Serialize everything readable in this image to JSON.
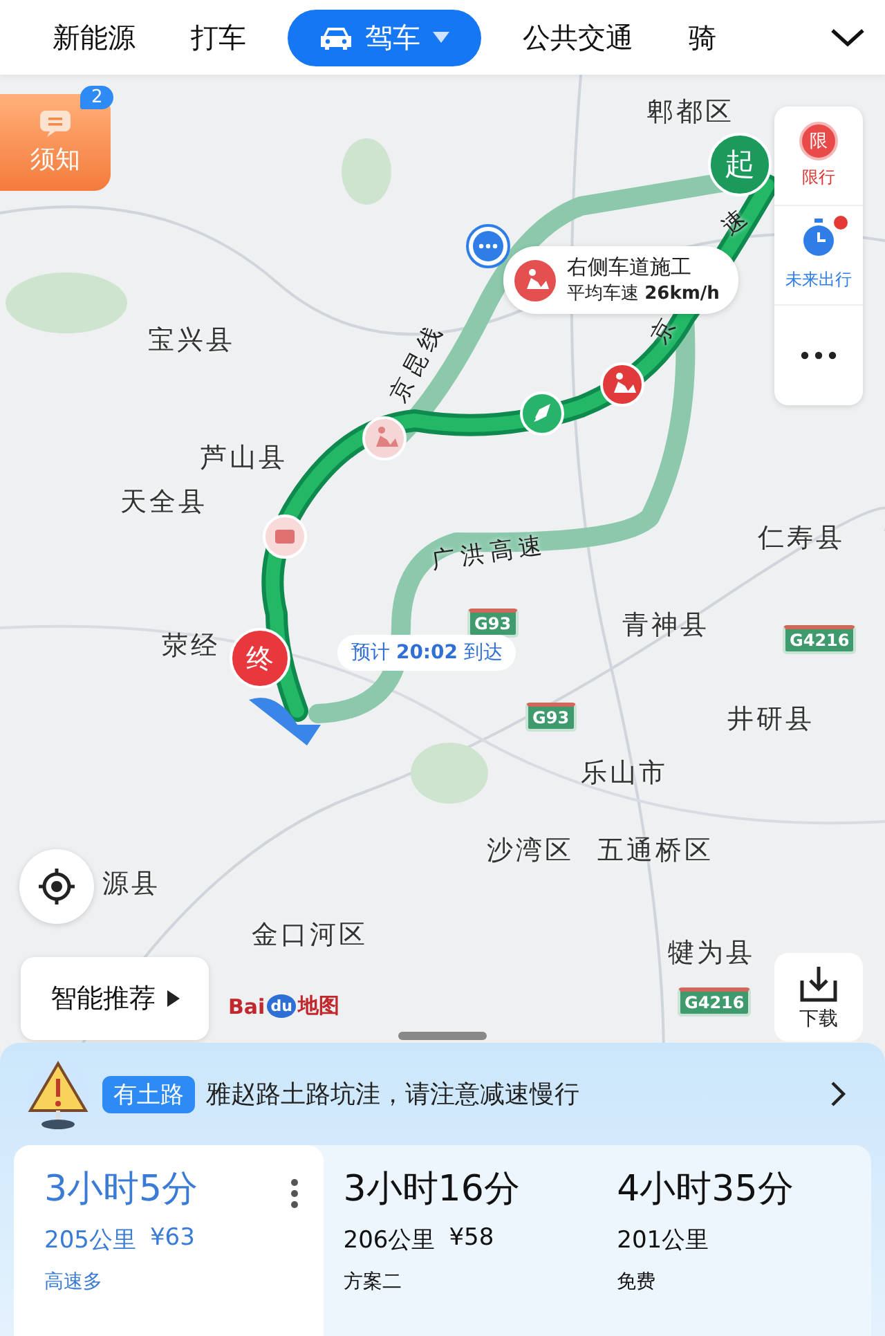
{
  "tabs": [
    {
      "label": "新能源",
      "selected": false
    },
    {
      "label": "打车",
      "selected": false
    },
    {
      "label": "驾车",
      "selected": true
    },
    {
      "label": "公共交通",
      "selected": false
    },
    {
      "label": "骑",
      "selected": false
    }
  ],
  "notice_button": {
    "label": "须知",
    "badge": "2"
  },
  "side_panel": [
    {
      "kind": "restriction",
      "label": "限行",
      "icon_text": "限"
    },
    {
      "kind": "timer",
      "label": "未来出行",
      "dot": true
    },
    {
      "kind": "more"
    }
  ],
  "map": {
    "places": [
      "郫都区",
      "宝兴县",
      "芦山县",
      "天全县",
      "荥经",
      "仁寿县",
      "青神县",
      "井研县",
      "乐山市",
      "沙湾区",
      "五通桥区",
      "金口河区",
      "犍为县",
      "源县"
    ],
    "roads": [
      "京昆线",
      "广洪高速",
      "京",
      "速"
    ],
    "shields": [
      "G93",
      "G93",
      "G4216",
      "G4216"
    ],
    "start_marker": "起",
    "end_marker": "终",
    "traffic_callout": {
      "title": "右侧车道施工",
      "detail": "平均车速 **26km/h**"
    },
    "eta": "预计 **20:02** 到达"
  },
  "smart_recommend": "智能推荐",
  "logo": {
    "brand_a": "Bai",
    "brand_b": "du",
    "suffix": "地图"
  },
  "download": "下载",
  "alert": {
    "tag": "有土路",
    "text": "雅赵路土路坑洼，请注意减速慢行"
  },
  "routes": [
    {
      "duration": "3小时5分",
      "distance": "205公里",
      "toll": "¥63",
      "note": "高速多",
      "selected": true
    },
    {
      "duration": "3小时16分",
      "distance": "206公里",
      "toll": "¥58",
      "note": "方案二",
      "selected": false
    },
    {
      "duration": "4小时35分",
      "distance": "201公里",
      "note": "免费",
      "selected": false
    }
  ]
}
